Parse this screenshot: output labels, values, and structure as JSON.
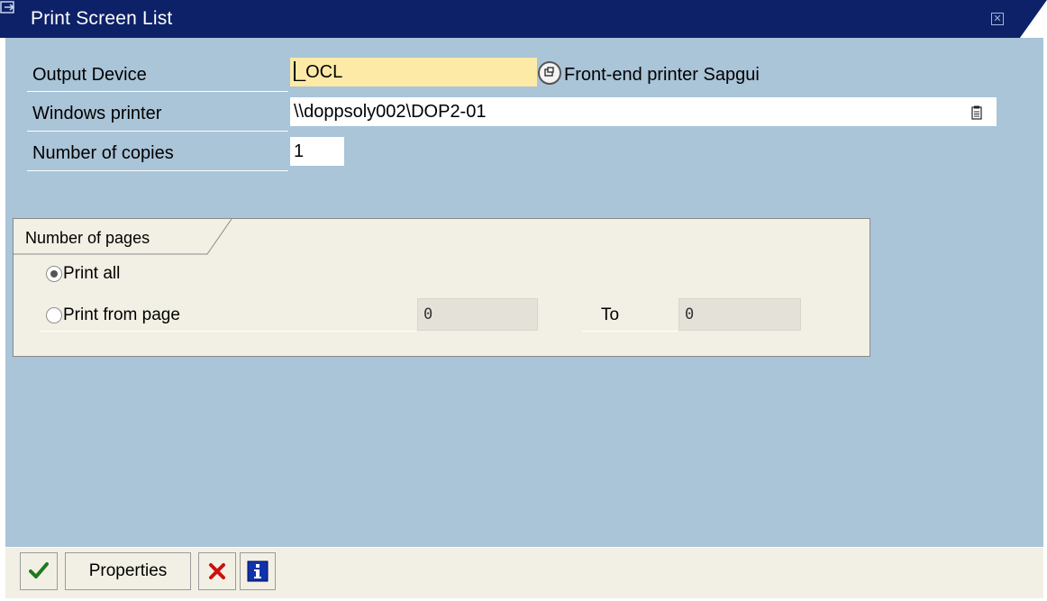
{
  "window": {
    "title": "Print Screen List",
    "title_icon": "print-dialog-icon",
    "close_icon": "close-icon"
  },
  "form": {
    "output_device": {
      "label": "Output Device",
      "value": "_OCL",
      "value_help_icon": "value-help-icon",
      "description": "Front-end printer Sapgui"
    },
    "windows_printer": {
      "label": "Windows printer",
      "value": "\\\\doppsoly002\\DOP2-01",
      "icon": "clipboard-icon"
    },
    "number_of_copies": {
      "label": "Number of copies",
      "value": "1"
    }
  },
  "pages_group": {
    "title": "Number of pages",
    "print_all_label": "Print all",
    "print_from_page_label": "Print from page",
    "from_value": "0",
    "to_label": "To",
    "to_value": "0",
    "selected": "print_all"
  },
  "footer": {
    "continue_icon": "checkmark-icon",
    "properties_label": "Properties",
    "cancel_icon": "cancel-x-icon",
    "info_icon": "info-icon"
  },
  "colors": {
    "title_bar": "#0d2168",
    "body_background": "#aac4d8",
    "required_field": "#fdeaa6",
    "group_background": "#f2f0e4"
  }
}
